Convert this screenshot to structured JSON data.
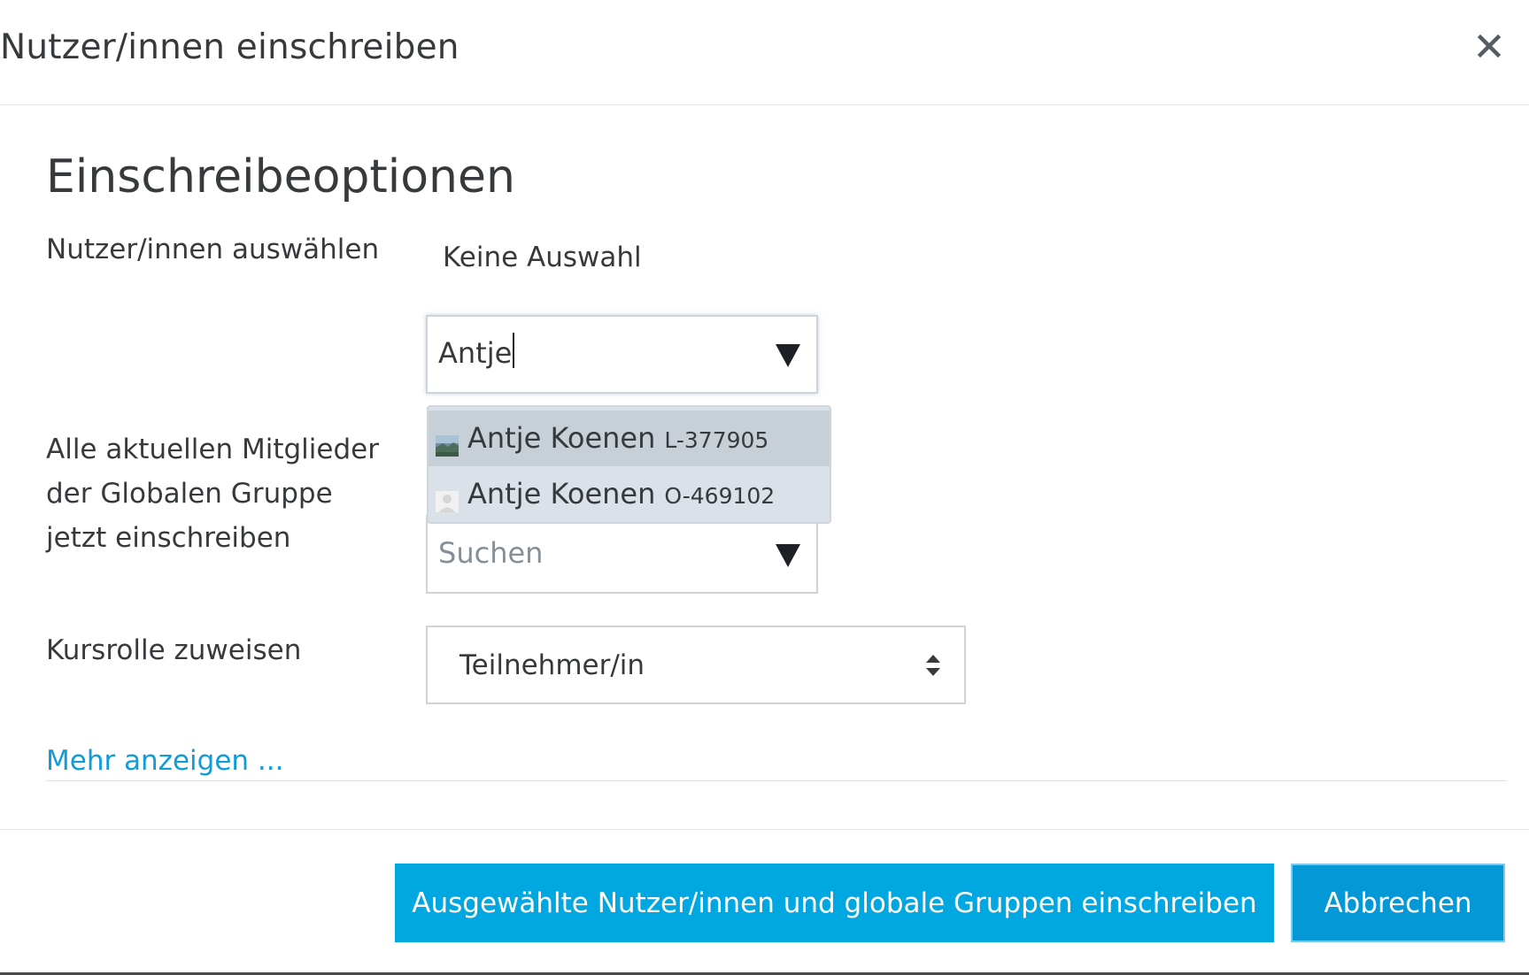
{
  "dialog": {
    "title": "Nutzer/innen einschreiben",
    "close_icon": "close-icon"
  },
  "form": {
    "heading": "Einschreibeoptionen",
    "select_users": {
      "label": "Nutzer/innen auswählen",
      "selection_text": "Keine Auswahl",
      "input_value": "Antje",
      "suggestions": [
        {
          "name": "Antje Koenen",
          "id": "L-377905",
          "avatar": "landscape-photo-avatar",
          "highlighted": true
        },
        {
          "name": "Antje Koenen",
          "id": "O-469102",
          "avatar": "default-user-avatar",
          "highlighted": false
        }
      ]
    },
    "global_group": {
      "label": "Alle aktuellen Mitglieder der Globalen Gruppe jetzt einschreiben",
      "placeholder": "Suchen"
    },
    "role": {
      "label": "Kursrolle zuweisen",
      "selected": "Teilnehmer/in"
    },
    "more_link": "Mehr anzeigen ..."
  },
  "footer": {
    "submit_label": "Ausgewählte Nutzer/innen und globale Gruppen einschreiben",
    "cancel_label": "Abbrechen"
  },
  "colors": {
    "primary": "#00a7e1",
    "secondary": "#0598d6",
    "link": "#0f9cd8",
    "suggestion_highlight": "#c8d0d7"
  }
}
